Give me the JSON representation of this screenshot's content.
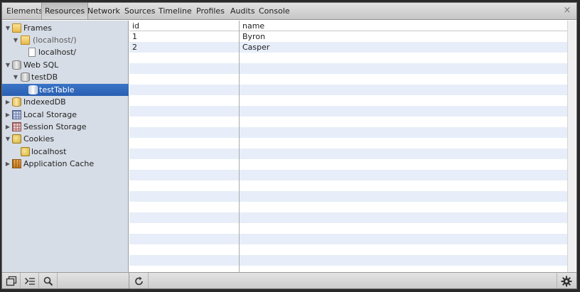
{
  "toolbar": {
    "tabs": [
      {
        "label": "Elements"
      },
      {
        "label": "Resources",
        "selected": true
      },
      {
        "label": "Network"
      },
      {
        "label": "Sources"
      },
      {
        "label": "Timeline"
      },
      {
        "label": "Profiles"
      },
      {
        "label": "Audits"
      },
      {
        "label": "Console"
      }
    ],
    "close_glyph": "×"
  },
  "sidebar": {
    "items": [
      {
        "label": "Frames",
        "icon": "folder-icon",
        "expanded": true
      },
      {
        "label": "(localhost/)",
        "icon": "folder-icon",
        "expanded": true
      },
      {
        "label": "localhost/",
        "icon": "page-icon"
      },
      {
        "label": "Web SQL",
        "icon": "database-icon",
        "expanded": true
      },
      {
        "label": "testDB",
        "icon": "database-icon",
        "expanded": true
      },
      {
        "label": "testTable",
        "icon": "table-icon",
        "selected": true
      },
      {
        "label": "IndexedDB",
        "icon": "indexeddb-icon",
        "expanded": false
      },
      {
        "label": "Local Storage",
        "icon": "local-storage-icon",
        "expanded": false
      },
      {
        "label": "Session Storage",
        "icon": "session-storage-icon",
        "expanded": false
      },
      {
        "label": "Cookies",
        "icon": "cookie-icon",
        "expanded": true
      },
      {
        "label": "localhost",
        "icon": "cookie-icon"
      },
      {
        "label": "Application Cache",
        "icon": "application-cache-icon",
        "expanded": false
      }
    ]
  },
  "grid": {
    "columns": [
      "id",
      "name"
    ],
    "rows": [
      [
        "1",
        "Byron"
      ],
      [
        "2",
        "Casper"
      ]
    ]
  },
  "statusbar": {
    "buttons": [
      "dock-icon",
      "console-drawer-icon",
      "search-icon",
      "refresh-icon",
      "gear-icon"
    ]
  }
}
